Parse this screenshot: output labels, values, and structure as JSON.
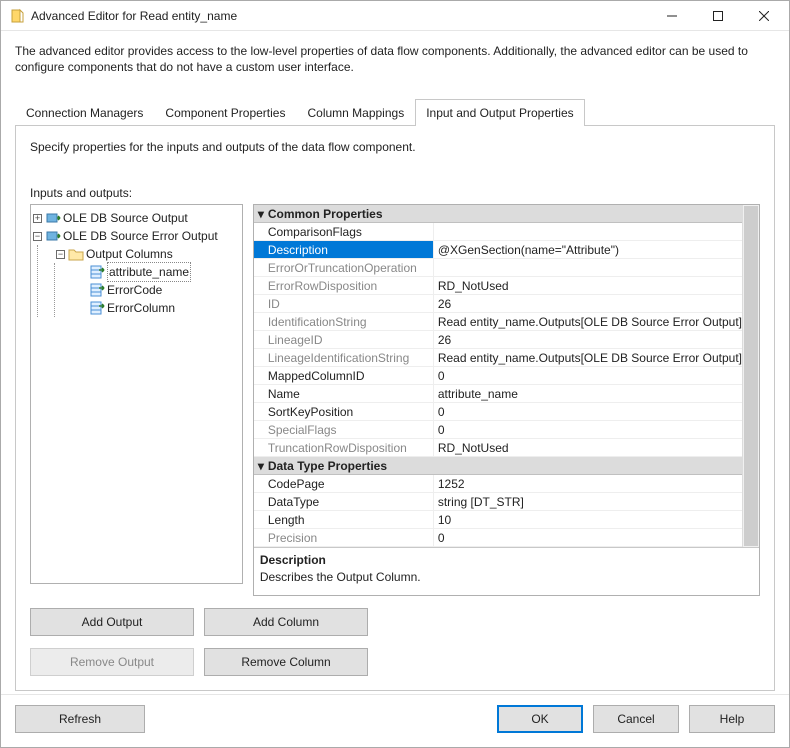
{
  "window": {
    "title": "Advanced Editor for Read entity_name"
  },
  "description": "The advanced editor provides access to the low-level properties of data flow components. Additionally, the advanced editor can be used to configure components that do not have a custom user interface.",
  "tabs": {
    "items": [
      {
        "label": "Connection Managers"
      },
      {
        "label": "Component Properties"
      },
      {
        "label": "Column Mappings"
      },
      {
        "label": "Input and Output Properties"
      }
    ],
    "active": 3
  },
  "io": {
    "instruction": "Specify properties for the inputs and outputs of the data flow component.",
    "label": "Inputs and outputs:",
    "tree": {
      "nodes": [
        {
          "label": "OLE DB Source Output"
        },
        {
          "label": "OLE DB Source Error Output"
        },
        {
          "label": "Output Columns"
        },
        {
          "label": "attribute_name",
          "selected": true
        },
        {
          "label": "ErrorCode"
        },
        {
          "label": "ErrorColumn"
        }
      ]
    }
  },
  "props": {
    "categories": [
      {
        "name": "Common Properties",
        "rows": [
          {
            "key": "ComparisonFlags",
            "val": ""
          },
          {
            "key": "Description",
            "val": "@XGenSection(name=\"Attribute\")",
            "selected": true
          },
          {
            "key": "ErrorOrTruncationOperation",
            "val": "",
            "readonly": true
          },
          {
            "key": "ErrorRowDisposition",
            "val": "RD_NotUsed",
            "readonly": true
          },
          {
            "key": "ID",
            "val": "26",
            "readonly": true
          },
          {
            "key": "IdentificationString",
            "val": "Read entity_name.Outputs[OLE DB Source Error Output]",
            "readonly": true
          },
          {
            "key": "LineageID",
            "val": "26",
            "readonly": true
          },
          {
            "key": "LineageIdentificationString",
            "val": "Read entity_name.Outputs[OLE DB Source Error Output]",
            "readonly": true
          },
          {
            "key": "MappedColumnID",
            "val": "0"
          },
          {
            "key": "Name",
            "val": "attribute_name"
          },
          {
            "key": "SortKeyPosition",
            "val": "0"
          },
          {
            "key": "SpecialFlags",
            "val": "0",
            "readonly": true
          },
          {
            "key": "TruncationRowDisposition",
            "val": "RD_NotUsed",
            "readonly": true
          }
        ]
      },
      {
        "name": "Data Type Properties",
        "rows": [
          {
            "key": "CodePage",
            "val": "1252"
          },
          {
            "key": "DataType",
            "val": "string [DT_STR]"
          },
          {
            "key": "Length",
            "val": "10"
          },
          {
            "key": "Precision",
            "val": "0",
            "readonly": true
          }
        ]
      }
    ],
    "desc": {
      "title": "Description",
      "text": "Describes the Output Column."
    }
  },
  "buttons": {
    "add_output": "Add Output",
    "add_column": "Add Column",
    "remove_output": "Remove Output",
    "remove_column": "Remove Column",
    "refresh": "Refresh",
    "ok": "OK",
    "cancel": "Cancel",
    "help": "Help"
  }
}
